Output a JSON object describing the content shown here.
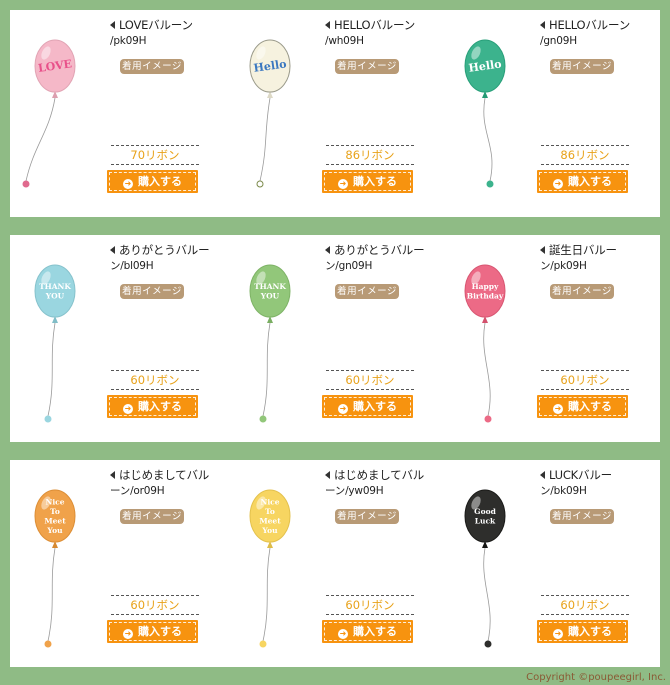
{
  "labels": {
    "image_button": "着用イメージ",
    "buy_button": "購入する"
  },
  "panels": [
    {
      "items": [
        {
          "name": "LOVEバルーン",
          "code": "/pk09H",
          "price": "70リボン",
          "balloon": {
            "text": [
              "LOVE"
            ],
            "color": "#f5b8c8",
            "text_color": "#e8508a",
            "dot": "#e06a8e",
            "style": "heart"
          }
        },
        {
          "name": "HELLOバルーン",
          "code": "/wh09H",
          "price": "86リボン",
          "balloon": {
            "text": [
              "Hello"
            ],
            "color": "#f6f2df",
            "text_color": "#3b78c0",
            "dot": "#ffffff",
            "style": "plain"
          }
        },
        {
          "name": "HELLOバルーン",
          "code": "/gn09H",
          "price": "86リボン",
          "balloon": {
            "text": [
              "Hello"
            ],
            "color": "#3cb38d",
            "text_color": "#ffffff",
            "dot": "#3cb38d",
            "style": "plain"
          }
        }
      ]
    },
    {
      "items": [
        {
          "name": "ありがとうバルー",
          "code": "ン/bl09H",
          "price": "60リボン",
          "balloon": {
            "text": [
              "THANK",
              "YOU"
            ],
            "color": "#9ad6e0",
            "text_color": "#ffffff",
            "dot": "#9ad6e0",
            "style": "plain"
          }
        },
        {
          "name": "ありがとうバルー",
          "code": "ン/gn09H",
          "price": "60リボン",
          "balloon": {
            "text": [
              "THANK",
              "YOU"
            ],
            "color": "#92c77a",
            "text_color": "#ffffff",
            "dot": "#92c77a",
            "style": "plain"
          }
        },
        {
          "name": "誕生日バルー",
          "code": "ン/pk09H",
          "price": "60リボン",
          "balloon": {
            "text": [
              "Happy",
              "Birthday"
            ],
            "color": "#ec6a86",
            "text_color": "#ffffff",
            "dot": "#ec6a86",
            "style": "plain"
          }
        }
      ]
    },
    {
      "items": [
        {
          "name": "はじめましてバル",
          "code": "ーン/or09H",
          "price": "60リボン",
          "balloon": {
            "text": [
              "Nice",
              "To",
              "Meet",
              "You"
            ],
            "color": "#f0a24a",
            "text_color": "#ffffff",
            "dot": "#f0a24a",
            "style": "plain"
          }
        },
        {
          "name": "はじめましてバル",
          "code": "ーン/yw09H",
          "price": "60リボン",
          "balloon": {
            "text": [
              "Nice",
              "To",
              "Meet",
              "You"
            ],
            "color": "#f7d561",
            "text_color": "#ffffff",
            "dot": "#f7d561",
            "style": "plain"
          }
        },
        {
          "name": "LUCKバルー",
          "code": "ン/bk09H",
          "price": "60リボン",
          "balloon": {
            "text": [
              "Good",
              "Luck"
            ],
            "color": "#2e2e2c",
            "text_color": "#ffffff",
            "dot": "#2e2e2c",
            "style": "plain"
          }
        }
      ]
    }
  ],
  "copyright": "Copyright ©poupeegirl, Inc."
}
